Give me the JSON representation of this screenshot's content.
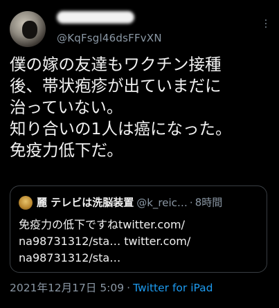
{
  "tweet": {
    "handle": "@KqFsgl46dsFFvXN",
    "text": "僕の嫁の友達もワクチン接種\n後、帯状疱疹が出ていまだに\n治っていない。\n知り合いの1人は癌になった。\n免疫力低下だ。",
    "timestamp": "2021年12月17日 5:09",
    "separator": "·",
    "source": "Twitter for iPad",
    "more_icon": "more-vertical-icon"
  },
  "quote": {
    "name": "麗 テレビは洗脳装置",
    "handle": "@k_reic…",
    "separator": "·",
    "time": "8時間",
    "text": "免疫力の低下ですねtwitter.com/\nna98731312/sta… twitter.com/\nna98731312/sta…"
  },
  "colors": {
    "background": "#000000",
    "text": "#f2f2f2",
    "secondary": "#8b98a5",
    "link": "#1d9bf0",
    "border": "#3a3f44"
  }
}
